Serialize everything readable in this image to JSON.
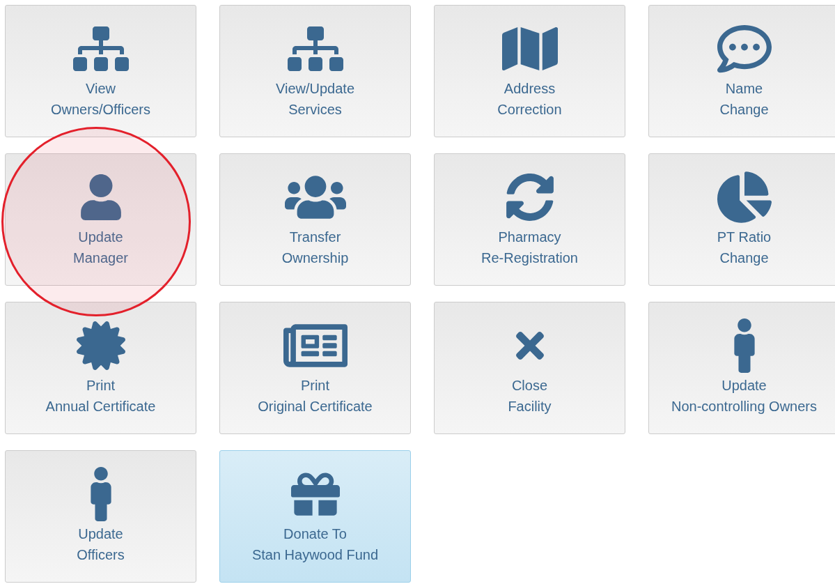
{
  "tiles": [
    {
      "lines": [
        "View",
        "Owners/Officers"
      ],
      "circled": false,
      "active": false
    },
    {
      "lines": [
        "View/Update",
        "Services"
      ],
      "circled": false,
      "active": false
    },
    {
      "lines": [
        "Address",
        "Correction"
      ],
      "circled": false,
      "active": false
    },
    {
      "lines": [
        "Name",
        "Change"
      ],
      "circled": false,
      "active": false
    },
    {
      "lines": [
        "Update",
        "Manager"
      ],
      "circled": true,
      "active": false
    },
    {
      "lines": [
        "Transfer",
        "Ownership"
      ],
      "circled": false,
      "active": false
    },
    {
      "lines": [
        "Pharmacy",
        "Re-Registration"
      ],
      "circled": false,
      "active": false
    },
    {
      "lines": [
        "PT Ratio",
        "Change"
      ],
      "circled": false,
      "active": false
    },
    {
      "lines": [
        "Print",
        "Annual Certificate"
      ],
      "circled": false,
      "active": false
    },
    {
      "lines": [
        "Print",
        "Original Certificate"
      ],
      "circled": false,
      "active": false
    },
    {
      "lines": [
        "Close",
        "Facility"
      ],
      "circled": false,
      "active": false
    },
    {
      "lines": [
        "Update",
        "Non-controlling Owners"
      ],
      "circled": false,
      "active": false
    },
    {
      "lines": [
        "Update",
        "Officers"
      ],
      "circled": false,
      "active": false
    },
    {
      "lines": [
        "Donate To",
        "Stan Haywood Fund"
      ],
      "circled": false,
      "active": true
    }
  ]
}
